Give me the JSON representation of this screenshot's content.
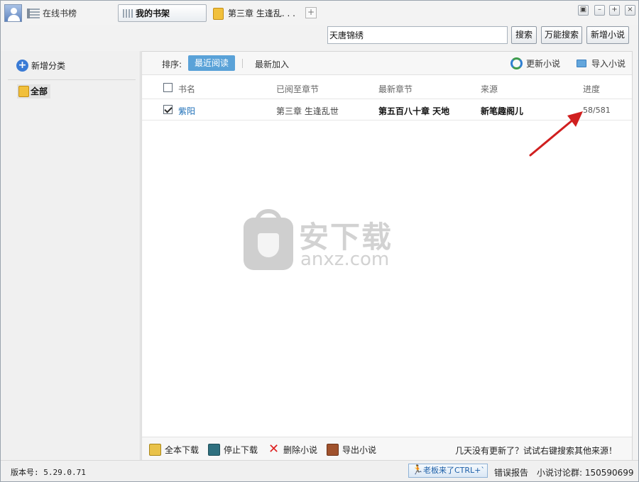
{
  "titlebar": {
    "tabs": [
      {
        "label": "在线书榜",
        "icon": "ranking-list-icon"
      },
      {
        "label": "我的书架",
        "icon": "bookshelf-icon",
        "active": true
      },
      {
        "label": "第三章 生逢乱. . .",
        "icon": "book-icon"
      }
    ],
    "add_tab": "+",
    "window_buttons": [
      "▣",
      "–",
      "+",
      "×"
    ]
  },
  "search": {
    "value": "天唐锦绣",
    "buttons": {
      "search": "搜索",
      "universal": "万能搜索",
      "new_novel": "新增小说"
    }
  },
  "sidebar": {
    "add_category": "新增分类",
    "categories": [
      {
        "label": "全部",
        "selected": true
      }
    ]
  },
  "toolbar": {
    "sort_label": "排序:",
    "sort_options": [
      "最近阅读",
      "最新加入"
    ],
    "active_sort": "最近阅读",
    "update": "更新小说",
    "import": "导入小说"
  },
  "table": {
    "headers": [
      "书名",
      "已阅至章节",
      "最新章节",
      "来源",
      "进度"
    ],
    "rows": [
      {
        "checked": true,
        "name": "紫阳",
        "read_to": "第三章 生逢乱世",
        "latest": "第五百八十章  天地",
        "source": "新笔趣阁儿",
        "progress": "58/581"
      }
    ]
  },
  "watermark": {
    "cn": "安下载",
    "en": "anxz.com"
  },
  "bottombar": {
    "full_download": "全本下载",
    "stop_download": "停止下载",
    "delete": "删除小说",
    "export": "导出小说",
    "tip": "几天没有更新了？试试右键搜索其他来源！"
  },
  "status": {
    "version": "版本号: 5.29.0.71",
    "boss_key": "老板来了CTRL+`",
    "report": "错误报告",
    "group": "小说讨论群: 150590699"
  },
  "colors": {
    "accent": "#5aa2d8",
    "link": "#1d6fb8",
    "arrow": "#d01f1f"
  }
}
